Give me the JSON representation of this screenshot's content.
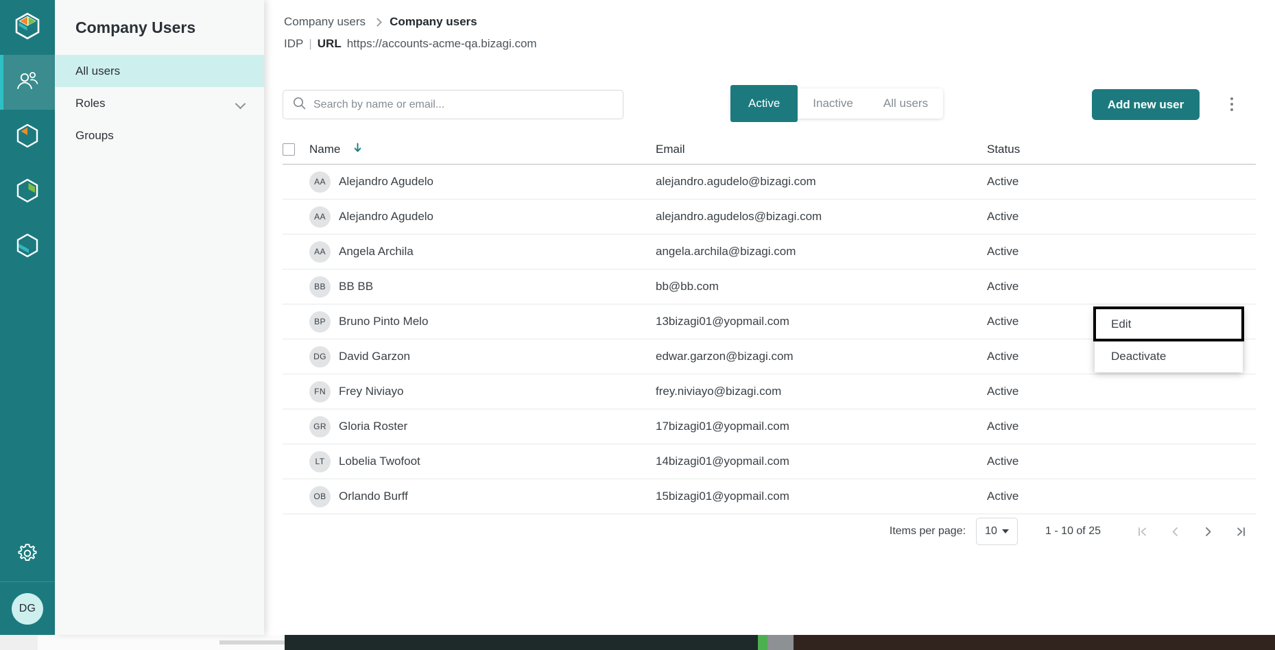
{
  "rail": {
    "logo_icon": "bizagi-cube-logo",
    "items": [
      {
        "name": "users",
        "icon": "people-icon",
        "active": true
      },
      {
        "name": "studio",
        "icon": "cube-orange-icon",
        "active": false
      },
      {
        "name": "automation",
        "icon": "cube-green-icon",
        "active": false
      },
      {
        "name": "sites",
        "icon": "cube-teal-icon",
        "active": false
      }
    ],
    "settings_icon": "gear-icon",
    "user_avatar_initials": "DG"
  },
  "navpanel": {
    "title": "Company Users",
    "items": [
      {
        "label": "All users",
        "selected": true,
        "expandable": false
      },
      {
        "label": "Roles",
        "selected": false,
        "expandable": true
      },
      {
        "label": "Groups",
        "selected": false,
        "expandable": false
      }
    ]
  },
  "breadcrumb": {
    "parent": "Company users",
    "current": "Company users"
  },
  "idp": {
    "label": "IDP",
    "divider": "|",
    "url_key": "URL",
    "url_value": "https://accounts-acme-qa.bizagi.com"
  },
  "toolbar": {
    "search_placeholder": "Search by name or email...",
    "search_value": "",
    "search_icon": "search-icon",
    "filters": [
      {
        "label": "Active",
        "selected": true
      },
      {
        "label": "Inactive",
        "selected": false
      },
      {
        "label": "All users",
        "selected": false
      }
    ],
    "add_user_label": "Add new user",
    "kebab_icon": "more-vertical-icon"
  },
  "table": {
    "columns": [
      "Name",
      "Email",
      "Status"
    ],
    "sort_column": "Name",
    "sort_direction": "descending",
    "sort_icon": "arrow-down-icon",
    "select_all_checked": false,
    "rows": [
      {
        "initials": "AA",
        "name": "Alejandro Agudelo",
        "email": "alejandro.agudelo@bizagi.com",
        "status": "Active"
      },
      {
        "initials": "AA",
        "name": "Alejandro Agudelo",
        "email": "alejandro.agudelos@bizagi.com",
        "status": "Active"
      },
      {
        "initials": "AA",
        "name": "Angela Archila",
        "email": "angela.archila@bizagi.com",
        "status": "Active"
      },
      {
        "initials": "BB",
        "name": "BB BB",
        "email": "bb@bb.com",
        "status": "Active"
      },
      {
        "initials": "BP",
        "name": "Bruno Pinto Melo",
        "email": "13bizagi01@yopmail.com",
        "status": "Active"
      },
      {
        "initials": "DG",
        "name": "David Garzon",
        "email": "edwar.garzon@bizagi.com",
        "status": "Active"
      },
      {
        "initials": "FN",
        "name": "Frey Niviayo",
        "email": "frey.niviayo@bizagi.com",
        "status": "Active"
      },
      {
        "initials": "GR",
        "name": "Gloria Roster",
        "email": "17bizagi01@yopmail.com",
        "status": "Active"
      },
      {
        "initials": "LT",
        "name": "Lobelia Twofoot",
        "email": "14bizagi01@yopmail.com",
        "status": "Active"
      },
      {
        "initials": "OB",
        "name": "Orlando Burff",
        "email": "15bizagi01@yopmail.com",
        "status": "Active"
      }
    ]
  },
  "context_menu": {
    "items": [
      {
        "label": "Edit",
        "focused": true
      },
      {
        "label": "Deactivate",
        "focused": false
      }
    ]
  },
  "paginator": {
    "items_per_page_label": "Items per page:",
    "items_per_page_value": "10",
    "range_text": "1 - 10 of 25",
    "first_icon": "first-page-icon",
    "prev_icon": "previous-page-icon",
    "next_icon": "next-page-icon",
    "last_icon": "last-page-icon"
  },
  "colors": {
    "brand_teal": "#1c7a7e",
    "rail_active": "#3a8c8e",
    "accent_cyan": "#2fc0c5",
    "nav_selected": "#cdf0ee",
    "text_primary": "#2b3137",
    "text_muted": "#868c92"
  }
}
